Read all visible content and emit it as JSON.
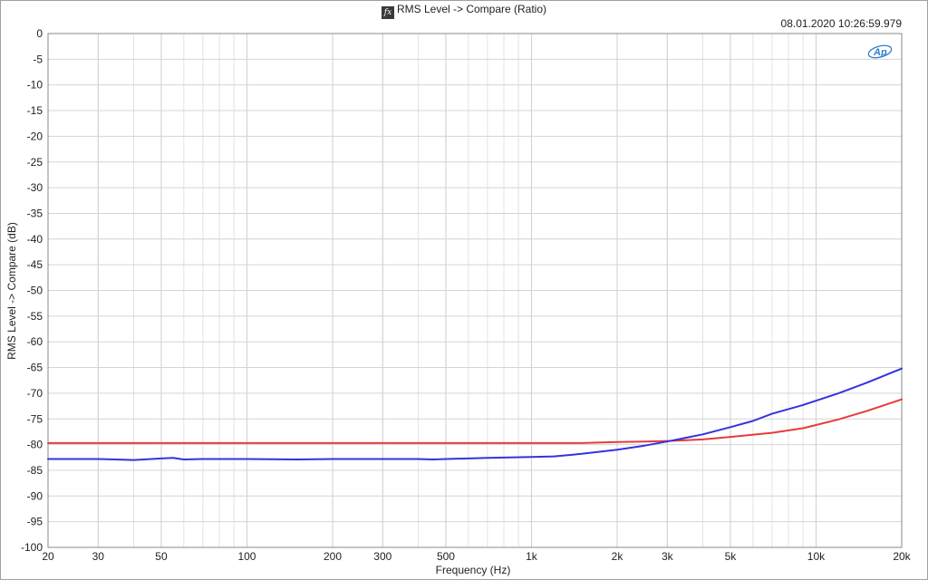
{
  "header": {
    "title": "RMS Level -> Compare (Ratio)",
    "timestamp": "08.01.2020 10:26:59.979",
    "fx_icon": "function-icon",
    "logo_text": "AP"
  },
  "chart_data": {
    "type": "line",
    "title": "RMS Level -> Compare (Ratio)",
    "xlabel": "Frequency (Hz)",
    "ylabel": "RMS Level -> Compare (dB)",
    "xscale": "log",
    "xlim": [
      20,
      20000
    ],
    "ylim": [
      -100,
      0
    ],
    "grid": true,
    "legend": "none",
    "x_ticks": [
      20,
      30,
      50,
      100,
      200,
      300,
      500,
      1000,
      2000,
      3000,
      5000,
      10000,
      20000
    ],
    "x_tick_labels": [
      "20",
      "30",
      "50",
      "100",
      "200",
      "300",
      "500",
      "1k",
      "2k",
      "3k",
      "5k",
      "10k",
      "20k"
    ],
    "y_ticks": [
      0,
      -5,
      -10,
      -15,
      -20,
      -25,
      -30,
      -35,
      -40,
      -45,
      -50,
      -55,
      -60,
      -65,
      -70,
      -75,
      -80,
      -85,
      -90,
      -95,
      -100
    ],
    "y_tick_labels": [
      "0",
      "-5",
      "-10",
      "-15",
      "-20",
      "-25",
      "-30",
      "-35",
      "-40",
      "-45",
      "-50",
      "-55",
      "-60",
      "-65",
      "-70",
      "-75",
      "-80",
      "-85",
      "-90",
      "-95",
      "-100"
    ],
    "series": [
      {
        "color": "#e83a3a",
        "x": [
          20,
          100,
          500,
          1000,
          1500,
          2000,
          2500,
          3000,
          4000,
          5000,
          7000,
          9000,
          12000,
          15000,
          20000
        ],
        "y": [
          -79.7,
          -79.7,
          -79.7,
          -79.7,
          -79.7,
          -79.5,
          -79.4,
          -79.3,
          -79,
          -78.5,
          -77.7,
          -76.8,
          -75.1,
          -73.5,
          -71.2
        ]
      },
      {
        "color": "#3333e0",
        "x": [
          20,
          30,
          40,
          50,
          55,
          60,
          70,
          100,
          150,
          200,
          300,
          400,
          450,
          500,
          700,
          1000,
          1200,
          1500,
          2000,
          2500,
          3000,
          4000,
          5000,
          6000,
          7000,
          9000,
          12000,
          15000,
          20000
        ],
        "y": [
          -82.8,
          -82.8,
          -83,
          -82.7,
          -82.6,
          -82.9,
          -82.8,
          -82.8,
          -82.9,
          -82.8,
          -82.8,
          -82.8,
          -82.9,
          -82.8,
          -82.6,
          -82.4,
          -82.3,
          -81.8,
          -81,
          -80.2,
          -79.4,
          -78,
          -76.6,
          -75.4,
          -74,
          -72.3,
          -70,
          -68,
          -65.2
        ]
      }
    ]
  }
}
